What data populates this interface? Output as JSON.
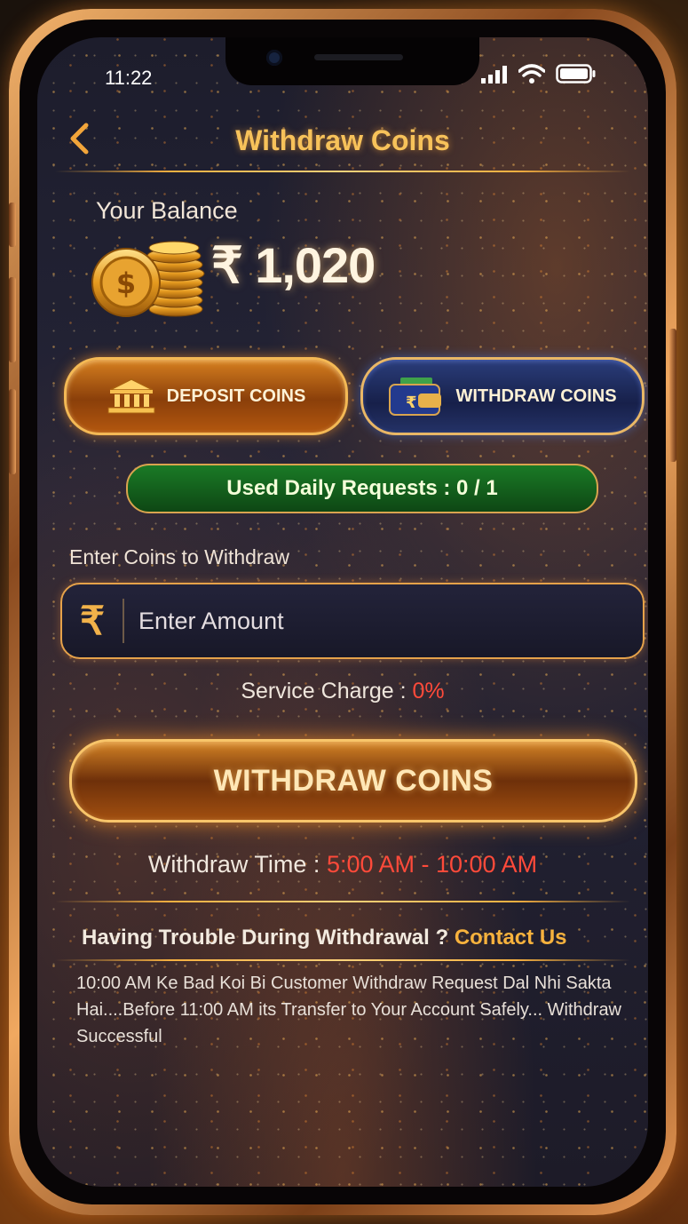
{
  "status_bar": {
    "time": "11:22"
  },
  "header": {
    "title": "Withdraw Coins",
    "back_icon": "chevron-left-icon"
  },
  "balance": {
    "label": "Your Balance",
    "value": "₹ 1,020"
  },
  "tabs": {
    "deposit_label": "DEPOSIT COINS",
    "withdraw_label": "WITHDRAW COINS"
  },
  "requests": {
    "text": "Used Daily Requests : 0 / 1"
  },
  "amount": {
    "label": "Enter Coins to Withdraw",
    "placeholder": "Enter Amount",
    "value": "",
    "currency_symbol": "₹"
  },
  "service": {
    "label": "Service Charge :",
    "value": "0%"
  },
  "withdraw_button": {
    "label": "WITHDRAW COINS"
  },
  "withdraw_time": {
    "label": "Withdraw Time :",
    "value": "5:00 AM - 10:00 AM"
  },
  "support": {
    "question": "Having Trouble During Withdrawal ?",
    "link": "Contact Us"
  },
  "note": "10:00 AM Ke Bad Koi Bi Customer Withdraw Request Dal Nhi Sakta Hai....Before 11:00 AM its Transfer to Your Account Safely... Withdraw Successful",
  "colors": {
    "accent_gold": "#f7c25a",
    "highlight_red": "#ff4a3a",
    "success_green": "#1a7a26",
    "tab_blue": "#17204a"
  }
}
